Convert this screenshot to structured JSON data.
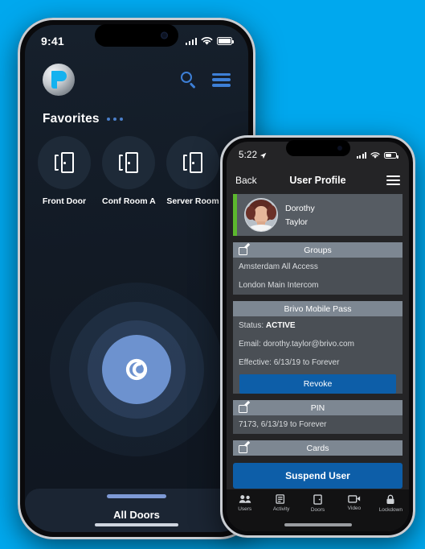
{
  "background_color": "#00a8ee",
  "phone1": {
    "status_bar": {
      "time": "9:41",
      "signal_icon": "cellular-bars-icon",
      "wifi_icon": "wifi-icon",
      "battery_icon": "battery-icon"
    },
    "header": {
      "logo_icon": "brivo-logo-icon",
      "search_icon": "search-icon",
      "menu_icon": "hamburger-menu-icon"
    },
    "favorites": {
      "title": "Favorites",
      "overflow_icon": "more-options-icon",
      "items": [
        {
          "label": "Front Door",
          "icon": "door-icon"
        },
        {
          "label": "Conf Room A",
          "icon": "door-icon"
        },
        {
          "label": "Server Room",
          "icon": "door-icon"
        },
        {
          "label": "",
          "icon": "door-icon"
        }
      ]
    },
    "pulse": {
      "icon": "unlock-swirl-icon"
    },
    "bottom_sheet": {
      "label": "All Doors",
      "handle_color": "#7e9ad6"
    }
  },
  "phone2": {
    "status_bar": {
      "time": "5:22",
      "location_icon": "location-arrow-icon",
      "signal_icon": "cellular-bars-icon",
      "wifi_icon": "wifi-icon",
      "battery_icon": "battery-icon"
    },
    "nav": {
      "back_label": "Back",
      "title": "User Profile",
      "menu_icon": "hamburger-menu-icon"
    },
    "profile": {
      "first_name": "Dorothy",
      "last_name": "Taylor",
      "avatar_icon": "user-avatar",
      "status_color": "#5cb82e"
    },
    "sections": [
      {
        "title": "Groups",
        "edit_icon": "edit-icon",
        "rows": [
          "Amsterdam All Access",
          "London Main Intercom"
        ]
      },
      {
        "title": "Brivo Mobile Pass",
        "edit_icon": null,
        "status_label": "Status:",
        "status_value": "ACTIVE",
        "email_label": "Email:",
        "email_value": "dorothy.taylor@brivo.com",
        "effective_label": "Effective:",
        "effective_value": "6/13/19 to Forever",
        "action_label": "Revoke"
      },
      {
        "title": "PIN",
        "edit_icon": "edit-icon",
        "rows": [
          "7173, 6/13/19 to Forever"
        ]
      },
      {
        "title": "Cards",
        "edit_icon": "edit-icon",
        "rows": []
      }
    ],
    "suspend_button": "Suspend User",
    "accent_blue": "#0d5ea8",
    "tabs": [
      {
        "label": "Users",
        "icon": "users-icon"
      },
      {
        "label": "Activity",
        "icon": "activity-icon"
      },
      {
        "label": "Doors",
        "icon": "door-icon"
      },
      {
        "label": "Video",
        "icon": "video-camera-icon"
      },
      {
        "label": "Lockdown",
        "icon": "lock-icon"
      }
    ]
  }
}
